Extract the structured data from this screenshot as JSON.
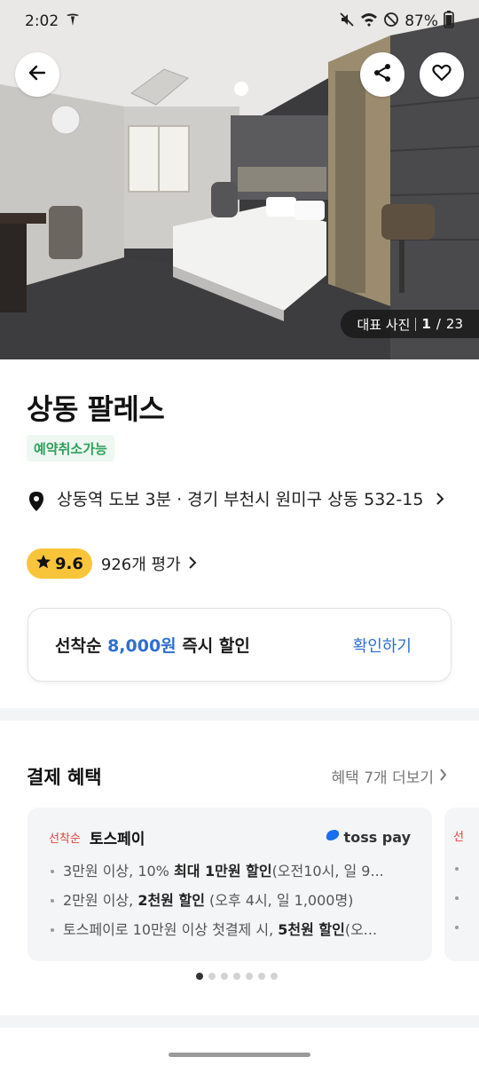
{
  "status_bar": {
    "time": "2:02",
    "battery": "87%"
  },
  "hero": {
    "photo_label": "대표 사진",
    "photo_index": "1",
    "photo_total": "23"
  },
  "hotel": {
    "name": "상동 팔레스",
    "cancel_tag": "예약취소가능",
    "address": "상동역 도보 3분 · 경기 부천시 원미구 상동 532-15",
    "rating": "9.6",
    "review_count": "926개 평가"
  },
  "coupon": {
    "prefix": "선착순",
    "amount": "8,000원",
    "suffix": "즉시 할인",
    "action": "확인하기"
  },
  "benefits": {
    "title": "결제 혜택",
    "more": "혜택 7개 더보기",
    "cards": [
      {
        "tag": "선착순",
        "name": "토스페이",
        "logo": "toss pay",
        "items": [
          {
            "a": "3만원 이상, 10% ",
            "b": "최대 1만원 할인",
            "c": "(오전10시, 일 9..."
          },
          {
            "a": "2만원 이상, ",
            "b": "2천원 할인",
            "c": " (오후 4시, 일 1,000명)"
          },
          {
            "a": "토스페이로 10만원 이상 첫결제 시, ",
            "b": "5천원 할인",
            "c": "(오..."
          }
        ]
      }
    ],
    "peek_tag": "선"
  },
  "carousel": {
    "count": 7,
    "active": 0
  }
}
